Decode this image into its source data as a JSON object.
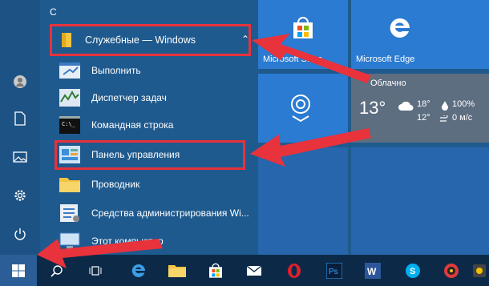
{
  "applist": {
    "letter": "С",
    "group_label": "Служебные — Windows",
    "items": [
      {
        "label": "Выполнить",
        "icon": "run-icon"
      },
      {
        "label": "Диспетчер задач",
        "icon": "task-manager-icon"
      },
      {
        "label": "Командная строка",
        "icon": "cmd-icon"
      },
      {
        "label": "Панель управления",
        "icon": "control-panel-icon"
      },
      {
        "label": "Проводник",
        "icon": "explorer-icon"
      },
      {
        "label": "Средства администрирования Wi...",
        "icon": "admin-tools-icon"
      },
      {
        "label": "Этот компьютер",
        "icon": "this-pc-icon"
      }
    ]
  },
  "tiles": {
    "store_label": "Microsoft Store",
    "edge_label": "Microsoft Edge",
    "weather": {
      "condition": "Облачно",
      "temp": "13°",
      "high": "18°",
      "low": "12°",
      "humidity": "100%",
      "wind": "0 м/с"
    }
  },
  "colors": {
    "accent_red": "#e8323c",
    "tile_blue": "#2a7bd1",
    "menu_bg": "#1f5a8e",
    "taskbar_bg": "#0c2a48"
  },
  "taskbar": {
    "items": [
      "windows-start-icon",
      "search-icon",
      "task-view-icon",
      "edge-icon",
      "explorer-icon",
      "store-icon",
      "mail-icon",
      "opera-icon",
      "photoshop-icon",
      "word-icon",
      "skype-icon",
      "app-icon",
      "app-icon-2"
    ]
  }
}
